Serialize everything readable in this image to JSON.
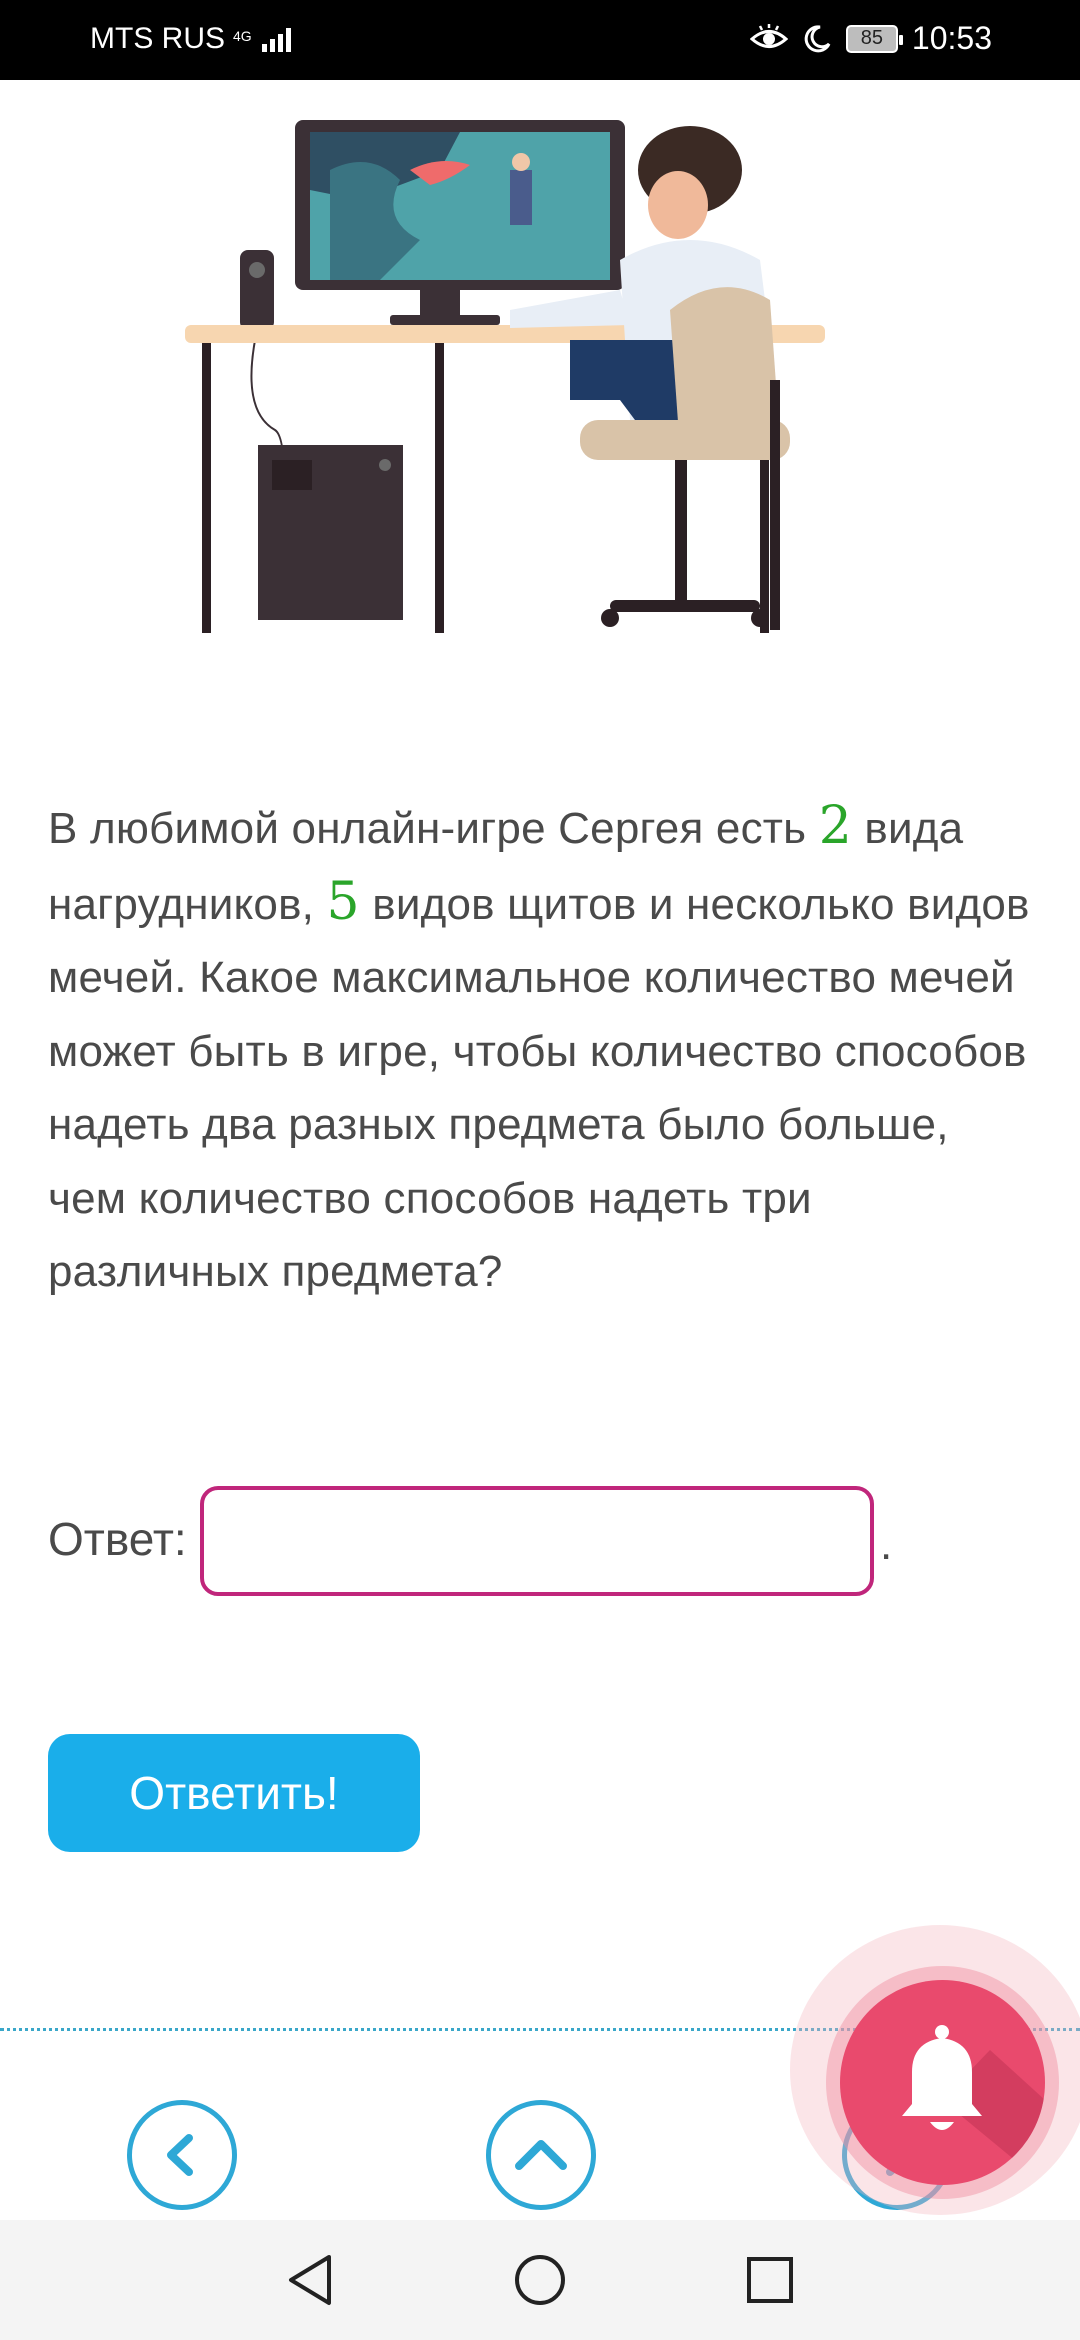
{
  "status_bar": {
    "carrier": "MTS RUS",
    "network": "4G",
    "battery": "85",
    "time": "10:53",
    "icons": [
      "signal-icon",
      "eye-icon",
      "moon-icon",
      "battery-icon"
    ]
  },
  "illustration": {
    "icon": "person-at-computer-illustration"
  },
  "question": {
    "part1": "В любимой онлайн-игре Сергея есть ",
    "num1": "2",
    "part2": " вида нагрудников, ",
    "num2": "5",
    "part3": " видов щитов и несколько видов мечей. Какое максимальное количество мечей может быть в игре, чтобы количество способов надеть два разных предмета было больше, чем количество способов надеть три различных предмета?"
  },
  "answer": {
    "label": "Ответ:",
    "value": "",
    "suffix": "."
  },
  "submit": {
    "label": "Ответить!"
  },
  "nav": {
    "prev_icon": "chevron-left-icon",
    "up_icon": "chevron-up-icon",
    "next_icon": "chevron-right-icon"
  },
  "fab": {
    "icon": "bell-icon"
  },
  "colors": {
    "number": "#2aa52a",
    "input_border": "#c0267b",
    "button": "#1aaeea",
    "nav": "#2ea8d6",
    "bell": "#e94a6d"
  }
}
